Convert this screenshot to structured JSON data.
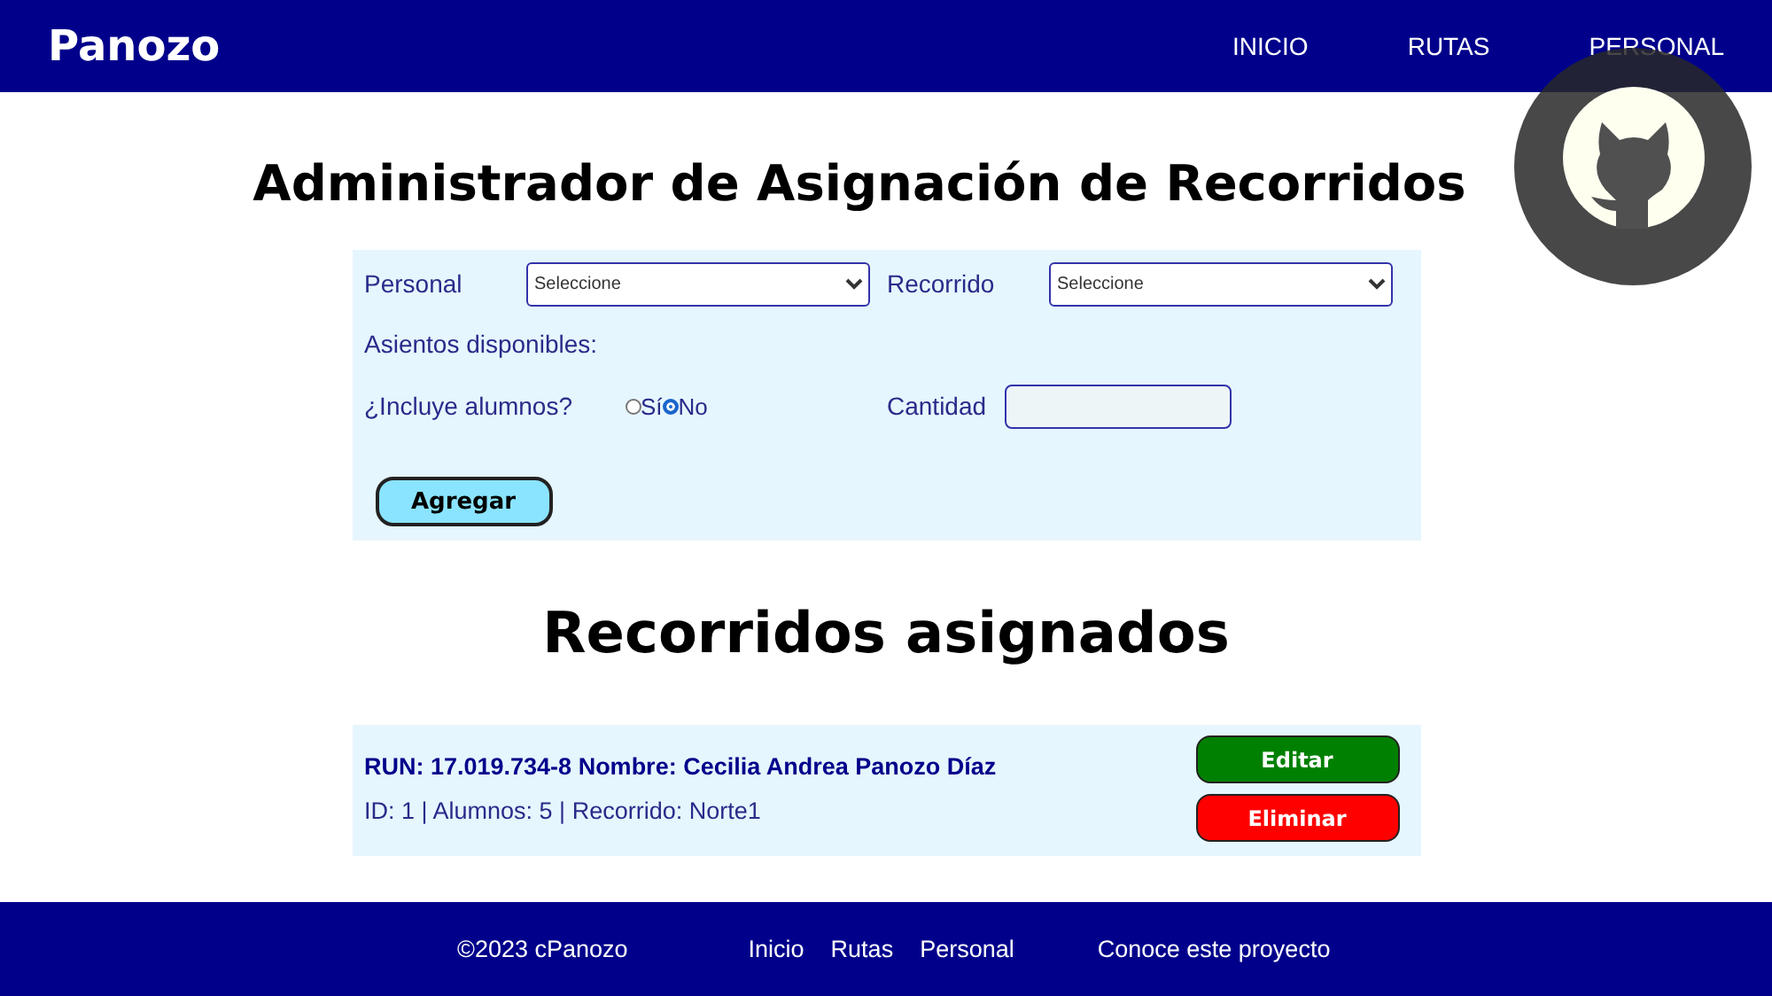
{
  "header": {
    "brand": "Panozo",
    "nav": [
      {
        "label": "INICIO"
      },
      {
        "label": "RUTAS"
      },
      {
        "label": "PERSONAL"
      }
    ]
  },
  "title": "Administrador de Asignación de Recorridos",
  "form": {
    "personal_label": "Personal",
    "personal_select": "Seleccione",
    "recorrido_label": "Recorrido",
    "recorrido_select": "Seleccione",
    "asientos_label": "Asientos disponibles:",
    "alumnos_label": "¿Incluye alumnos?",
    "options": [
      {
        "label": "Sí",
        "selected": false
      },
      {
        "label": "No",
        "selected": true
      }
    ],
    "cantidad_label": "Cantidad",
    "submit": "Agregar"
  },
  "assigned_title": "Recorridos asignados",
  "assignments": [
    {
      "heading": "RUN: 17.019.734-8 Nombre: Cecilia Andrea Panozo Díaz",
      "details": "ID: 1 | Alumnos: 5 | Recorrido: Norte1",
      "edit": "Editar",
      "delete": "Eliminar"
    }
  ],
  "footer": {
    "copyright": "©2023 cPanozo",
    "links": [
      {
        "label": "Inicio"
      },
      {
        "label": "Rutas"
      },
      {
        "label": "Personal"
      }
    ],
    "project": "Conoce este proyecto"
  }
}
